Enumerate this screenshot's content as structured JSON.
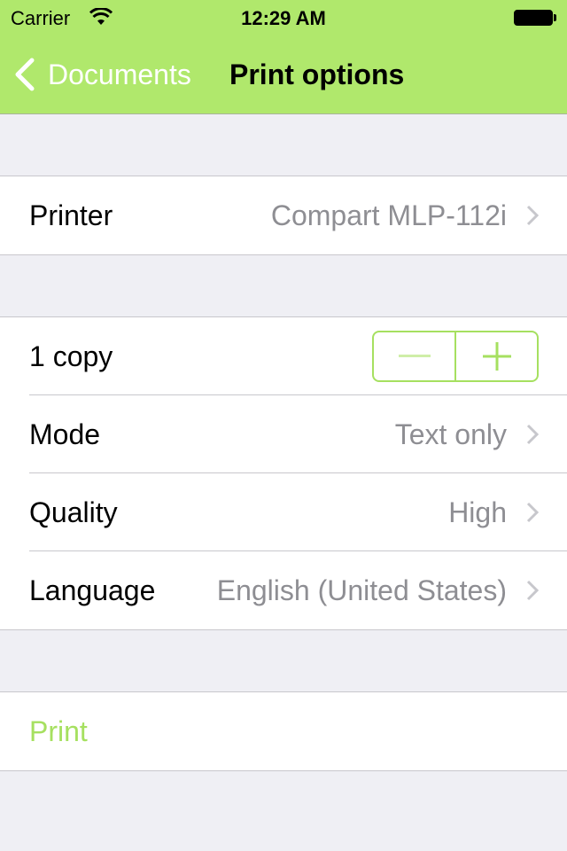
{
  "status_bar": {
    "carrier": "Carrier",
    "time": "12:29 AM"
  },
  "nav": {
    "back_label": "Documents",
    "title": "Print options"
  },
  "printer_row": {
    "label": "Printer",
    "value": "Compart MLP-112i"
  },
  "options": {
    "copies_label": "1 copy",
    "copies": 1,
    "decrement_symbol": "−",
    "increment_symbol": "+",
    "mode": {
      "label": "Mode",
      "value": "Text only"
    },
    "quality": {
      "label": "Quality",
      "value": "High"
    },
    "language": {
      "label": "Language",
      "value": "English (United States)"
    }
  },
  "actions": {
    "print_label": "Print"
  },
  "colors": {
    "accent": "#a6e060",
    "nav_background": "#b0e86c",
    "group_background": "#efeff4"
  }
}
